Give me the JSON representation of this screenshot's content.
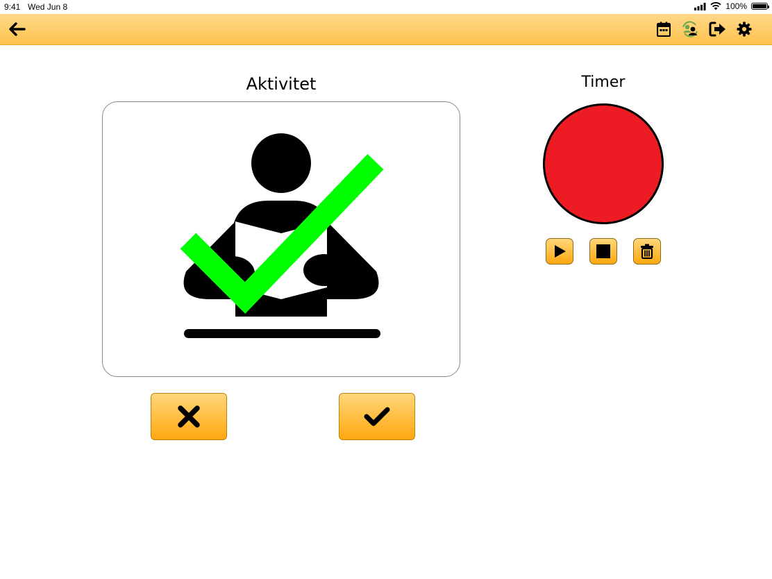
{
  "status": {
    "time": "9:41",
    "date": "Wed Jun 8",
    "battery": "100%"
  },
  "toolbar": {
    "back_icon": "arrow-left-icon",
    "icons": [
      "calendar-icon",
      "users-sync-icon",
      "sign-out-icon",
      "gear-icon"
    ]
  },
  "activity": {
    "title": "Aktivitet",
    "pictogram": "person-reading-icon",
    "completed_mark": "check-icon",
    "completed_color": "#00ff00",
    "reject_icon": "x-icon",
    "accept_icon": "check-icon"
  },
  "timer": {
    "title": "Timer",
    "color": "#ed1c24",
    "controls": [
      "play-icon",
      "stop-icon",
      "trash-icon"
    ]
  },
  "colors": {
    "accent_top": "#ffd98a",
    "accent_bottom": "#ffa70f"
  }
}
